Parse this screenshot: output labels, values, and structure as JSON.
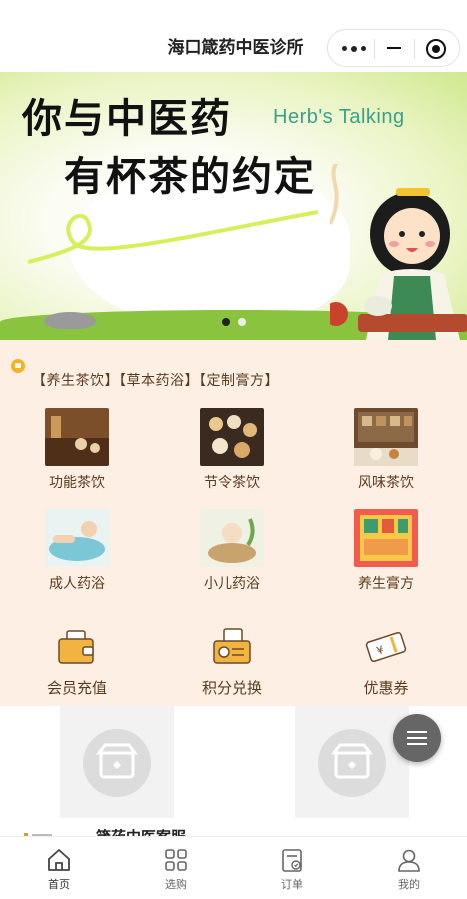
{
  "header": {
    "title": "海口箴药中医诊所"
  },
  "banner": {
    "title_line1": "你与中医药",
    "title_line2": "有杯茶的约定",
    "subtitle": "Herb's Talking"
  },
  "notice": {
    "text": "【养生茶饮】【草本药浴】【定制膏方】"
  },
  "categories": [
    {
      "label": "功能茶饮",
      "icon": "tea-set-icon"
    },
    {
      "label": "节令茶饮",
      "icon": "tea-cups-icon"
    },
    {
      "label": "风味茶饮",
      "icon": "tea-shop-icon"
    },
    {
      "label": "成人药浴",
      "icon": "adult-bath-icon"
    },
    {
      "label": "小儿药浴",
      "icon": "child-bath-icon"
    },
    {
      "label": "养生膏方",
      "icon": "herbal-paste-icon"
    }
  ],
  "services": [
    {
      "label": "会员充值",
      "icon": "wallet-icon"
    },
    {
      "label": "积分兑换",
      "icon": "coin-box-icon"
    },
    {
      "label": "优惠券",
      "icon": "coupon-icon"
    }
  ],
  "store": {
    "name_partial": "箴药中医案服"
  },
  "tabbar": [
    {
      "label": "首页",
      "icon": "home-icon",
      "active": true
    },
    {
      "label": "选购",
      "icon": "grid-icon",
      "active": false
    },
    {
      "label": "订单",
      "icon": "order-icon",
      "active": false
    },
    {
      "label": "我的",
      "icon": "user-icon",
      "active": false
    }
  ],
  "colors": {
    "section_bg": "#fdefe3",
    "text_brown": "#5a3b1e",
    "accent_green": "#3aa08a",
    "notice_yellow": "#f5b323"
  }
}
